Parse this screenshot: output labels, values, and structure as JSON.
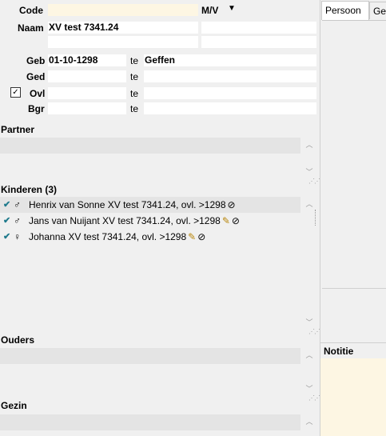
{
  "form": {
    "code_label": "Code",
    "code_value": "",
    "sex_label": "M/V",
    "name_label": "Naam",
    "name_value": "XV test 7341.24",
    "geb_label": "Geb",
    "geb_date": "01-10-1298",
    "geb_te": "te",
    "geb_place": "Geffen",
    "ged_label": "Ged",
    "ged_te": "te",
    "ovl_label": "Ovl",
    "ovl_te": "te",
    "bgr_label": "Bgr",
    "bgr_te": "te"
  },
  "sections": {
    "partner": "Partner",
    "kinderen": "Kinderen (3)",
    "ouders": "Ouders",
    "gezin": "Gezin"
  },
  "children": [
    {
      "sex_icon": "male-icon",
      "sex_glyph": "♂",
      "name": "Henrix van Sonne XV test 7341.24, ovl. >1298",
      "icons": "✎"
    },
    {
      "sex_icon": "male-icon",
      "sex_glyph": "♂",
      "name": "Jans van Nuijant XV test 7341.24, ovl. >1298",
      "icons": "✎"
    },
    {
      "sex_icon": "female-icon",
      "sex_glyph": "♀",
      "name": "Johanna XV test 7341.24, ovl. >1298",
      "icons": "✎"
    }
  ],
  "right_panel": {
    "tabs": [
      "Persoon",
      "Geb"
    ],
    "notitie_label": "Notitie"
  },
  "colors": {
    "note_bg": "#fdf6e3",
    "check_teal": "#1f7a8c"
  }
}
